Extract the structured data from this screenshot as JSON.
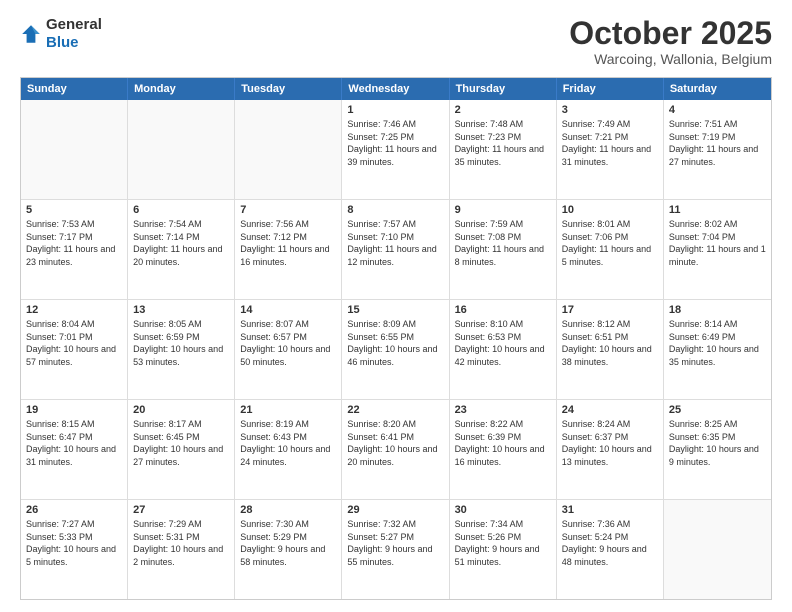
{
  "header": {
    "logo": {
      "general": "General",
      "blue": "Blue"
    },
    "title": "October 2025",
    "subtitle": "Warcoing, Wallonia, Belgium"
  },
  "dayHeaders": [
    "Sunday",
    "Monday",
    "Tuesday",
    "Wednesday",
    "Thursday",
    "Friday",
    "Saturday"
  ],
  "weeks": [
    [
      {
        "num": "",
        "info": ""
      },
      {
        "num": "",
        "info": ""
      },
      {
        "num": "",
        "info": ""
      },
      {
        "num": "1",
        "info": "Sunrise: 7:46 AM\nSunset: 7:25 PM\nDaylight: 11 hours\nand 39 minutes."
      },
      {
        "num": "2",
        "info": "Sunrise: 7:48 AM\nSunset: 7:23 PM\nDaylight: 11 hours\nand 35 minutes."
      },
      {
        "num": "3",
        "info": "Sunrise: 7:49 AM\nSunset: 7:21 PM\nDaylight: 11 hours\nand 31 minutes."
      },
      {
        "num": "4",
        "info": "Sunrise: 7:51 AM\nSunset: 7:19 PM\nDaylight: 11 hours\nand 27 minutes."
      }
    ],
    [
      {
        "num": "5",
        "info": "Sunrise: 7:53 AM\nSunset: 7:17 PM\nDaylight: 11 hours\nand 23 minutes."
      },
      {
        "num": "6",
        "info": "Sunrise: 7:54 AM\nSunset: 7:14 PM\nDaylight: 11 hours\nand 20 minutes."
      },
      {
        "num": "7",
        "info": "Sunrise: 7:56 AM\nSunset: 7:12 PM\nDaylight: 11 hours\nand 16 minutes."
      },
      {
        "num": "8",
        "info": "Sunrise: 7:57 AM\nSunset: 7:10 PM\nDaylight: 11 hours\nand 12 minutes."
      },
      {
        "num": "9",
        "info": "Sunrise: 7:59 AM\nSunset: 7:08 PM\nDaylight: 11 hours\nand 8 minutes."
      },
      {
        "num": "10",
        "info": "Sunrise: 8:01 AM\nSunset: 7:06 PM\nDaylight: 11 hours\nand 5 minutes."
      },
      {
        "num": "11",
        "info": "Sunrise: 8:02 AM\nSunset: 7:04 PM\nDaylight: 11 hours\nand 1 minute."
      }
    ],
    [
      {
        "num": "12",
        "info": "Sunrise: 8:04 AM\nSunset: 7:01 PM\nDaylight: 10 hours\nand 57 minutes."
      },
      {
        "num": "13",
        "info": "Sunrise: 8:05 AM\nSunset: 6:59 PM\nDaylight: 10 hours\nand 53 minutes."
      },
      {
        "num": "14",
        "info": "Sunrise: 8:07 AM\nSunset: 6:57 PM\nDaylight: 10 hours\nand 50 minutes."
      },
      {
        "num": "15",
        "info": "Sunrise: 8:09 AM\nSunset: 6:55 PM\nDaylight: 10 hours\nand 46 minutes."
      },
      {
        "num": "16",
        "info": "Sunrise: 8:10 AM\nSunset: 6:53 PM\nDaylight: 10 hours\nand 42 minutes."
      },
      {
        "num": "17",
        "info": "Sunrise: 8:12 AM\nSunset: 6:51 PM\nDaylight: 10 hours\nand 38 minutes."
      },
      {
        "num": "18",
        "info": "Sunrise: 8:14 AM\nSunset: 6:49 PM\nDaylight: 10 hours\nand 35 minutes."
      }
    ],
    [
      {
        "num": "19",
        "info": "Sunrise: 8:15 AM\nSunset: 6:47 PM\nDaylight: 10 hours\nand 31 minutes."
      },
      {
        "num": "20",
        "info": "Sunrise: 8:17 AM\nSunset: 6:45 PM\nDaylight: 10 hours\nand 27 minutes."
      },
      {
        "num": "21",
        "info": "Sunrise: 8:19 AM\nSunset: 6:43 PM\nDaylight: 10 hours\nand 24 minutes."
      },
      {
        "num": "22",
        "info": "Sunrise: 8:20 AM\nSunset: 6:41 PM\nDaylight: 10 hours\nand 20 minutes."
      },
      {
        "num": "23",
        "info": "Sunrise: 8:22 AM\nSunset: 6:39 PM\nDaylight: 10 hours\nand 16 minutes."
      },
      {
        "num": "24",
        "info": "Sunrise: 8:24 AM\nSunset: 6:37 PM\nDaylight: 10 hours\nand 13 minutes."
      },
      {
        "num": "25",
        "info": "Sunrise: 8:25 AM\nSunset: 6:35 PM\nDaylight: 10 hours\nand 9 minutes."
      }
    ],
    [
      {
        "num": "26",
        "info": "Sunrise: 7:27 AM\nSunset: 5:33 PM\nDaylight: 10 hours\nand 5 minutes."
      },
      {
        "num": "27",
        "info": "Sunrise: 7:29 AM\nSunset: 5:31 PM\nDaylight: 10 hours\nand 2 minutes."
      },
      {
        "num": "28",
        "info": "Sunrise: 7:30 AM\nSunset: 5:29 PM\nDaylight: 9 hours\nand 58 minutes."
      },
      {
        "num": "29",
        "info": "Sunrise: 7:32 AM\nSunset: 5:27 PM\nDaylight: 9 hours\nand 55 minutes."
      },
      {
        "num": "30",
        "info": "Sunrise: 7:34 AM\nSunset: 5:26 PM\nDaylight: 9 hours\nand 51 minutes."
      },
      {
        "num": "31",
        "info": "Sunrise: 7:36 AM\nSunset: 5:24 PM\nDaylight: 9 hours\nand 48 minutes."
      },
      {
        "num": "",
        "info": ""
      }
    ]
  ]
}
